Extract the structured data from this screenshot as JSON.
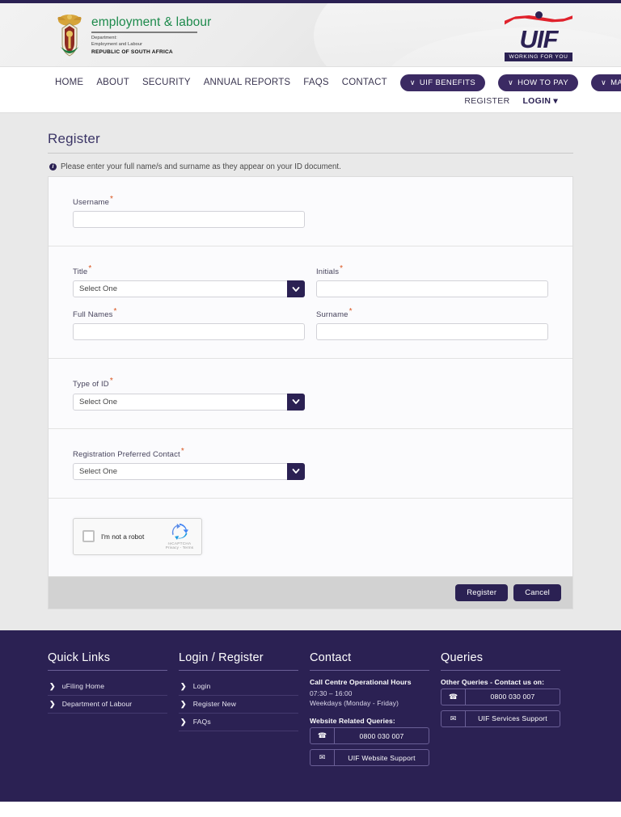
{
  "brand": {
    "title": "employment & labour",
    "dept_line1": "Department:",
    "dept_line2": "Employment and Labour",
    "country": "REPUBLIC OF SOUTH AFRICA",
    "uif_word": "UIF",
    "uif_tagline": "WORKING FOR YOU",
    "green": "#1d8a4c",
    "navy": "#2b2153",
    "red": "#e0222c"
  },
  "nav": {
    "items": [
      {
        "label": "HOME"
      },
      {
        "label": "ABOUT"
      },
      {
        "label": "SECURITY"
      },
      {
        "label": "ANNUAL REPORTS"
      },
      {
        "label": "FAQS"
      },
      {
        "label": "CONTACT"
      }
    ],
    "pills": [
      {
        "label": "UIF BENEFITS",
        "chevron": "∨"
      },
      {
        "label": "HOW TO PAY",
        "chevron": "∨"
      },
      {
        "label": "MANUALS",
        "chevron": "∨"
      }
    ],
    "register": "REGISTER",
    "login": "LOGIN",
    "login_caret": "▾"
  },
  "page": {
    "title": "Register",
    "info_message": "Please enter your full name/s and surname as they appear on your ID document.",
    "required_marker": "*"
  },
  "form": {
    "username": {
      "label": "Username",
      "value": "",
      "placeholder": ""
    },
    "title": {
      "label": "Title",
      "value": "Select One"
    },
    "initials": {
      "label": "Initials",
      "value": "",
      "placeholder": ""
    },
    "full_names": {
      "label": "Full Names",
      "value": "",
      "placeholder": ""
    },
    "surname": {
      "label": "Surname",
      "value": "",
      "placeholder": ""
    },
    "type_of_id": {
      "label": "Type of ID",
      "value": "Select One"
    },
    "preferred_contact": {
      "label": "Registration Preferred Contact",
      "value": "Select One"
    }
  },
  "recaptcha": {
    "label": "I'm not a robot",
    "brand": "reCAPTCHA",
    "terms": "Privacy - Terms"
  },
  "actions": {
    "register": "Register",
    "cancel": "Cancel"
  },
  "footer": {
    "quick_links": {
      "heading": "Quick Links",
      "items": [
        {
          "label": "uFiling Home"
        },
        {
          "label": "Department of Labour"
        }
      ]
    },
    "login_register": {
      "heading": "Login / Register",
      "items": [
        {
          "label": "Login"
        },
        {
          "label": "Register New"
        },
        {
          "label": "FAQs"
        }
      ]
    },
    "contact": {
      "heading": "Contact",
      "hours_title": "Call Centre Operational Hours",
      "hours_time": "07:30 – 16:00",
      "hours_days": "Weekdays (Monday - Friday)",
      "queries_title": "Website Related Queries:",
      "phone": "0800 030 007",
      "email": "UIF Website Support"
    },
    "queries": {
      "heading": "Queries",
      "other_title": "Other Queries - Contact us on:",
      "phone": "0800 030 007",
      "email": "UIF Services Support"
    }
  }
}
